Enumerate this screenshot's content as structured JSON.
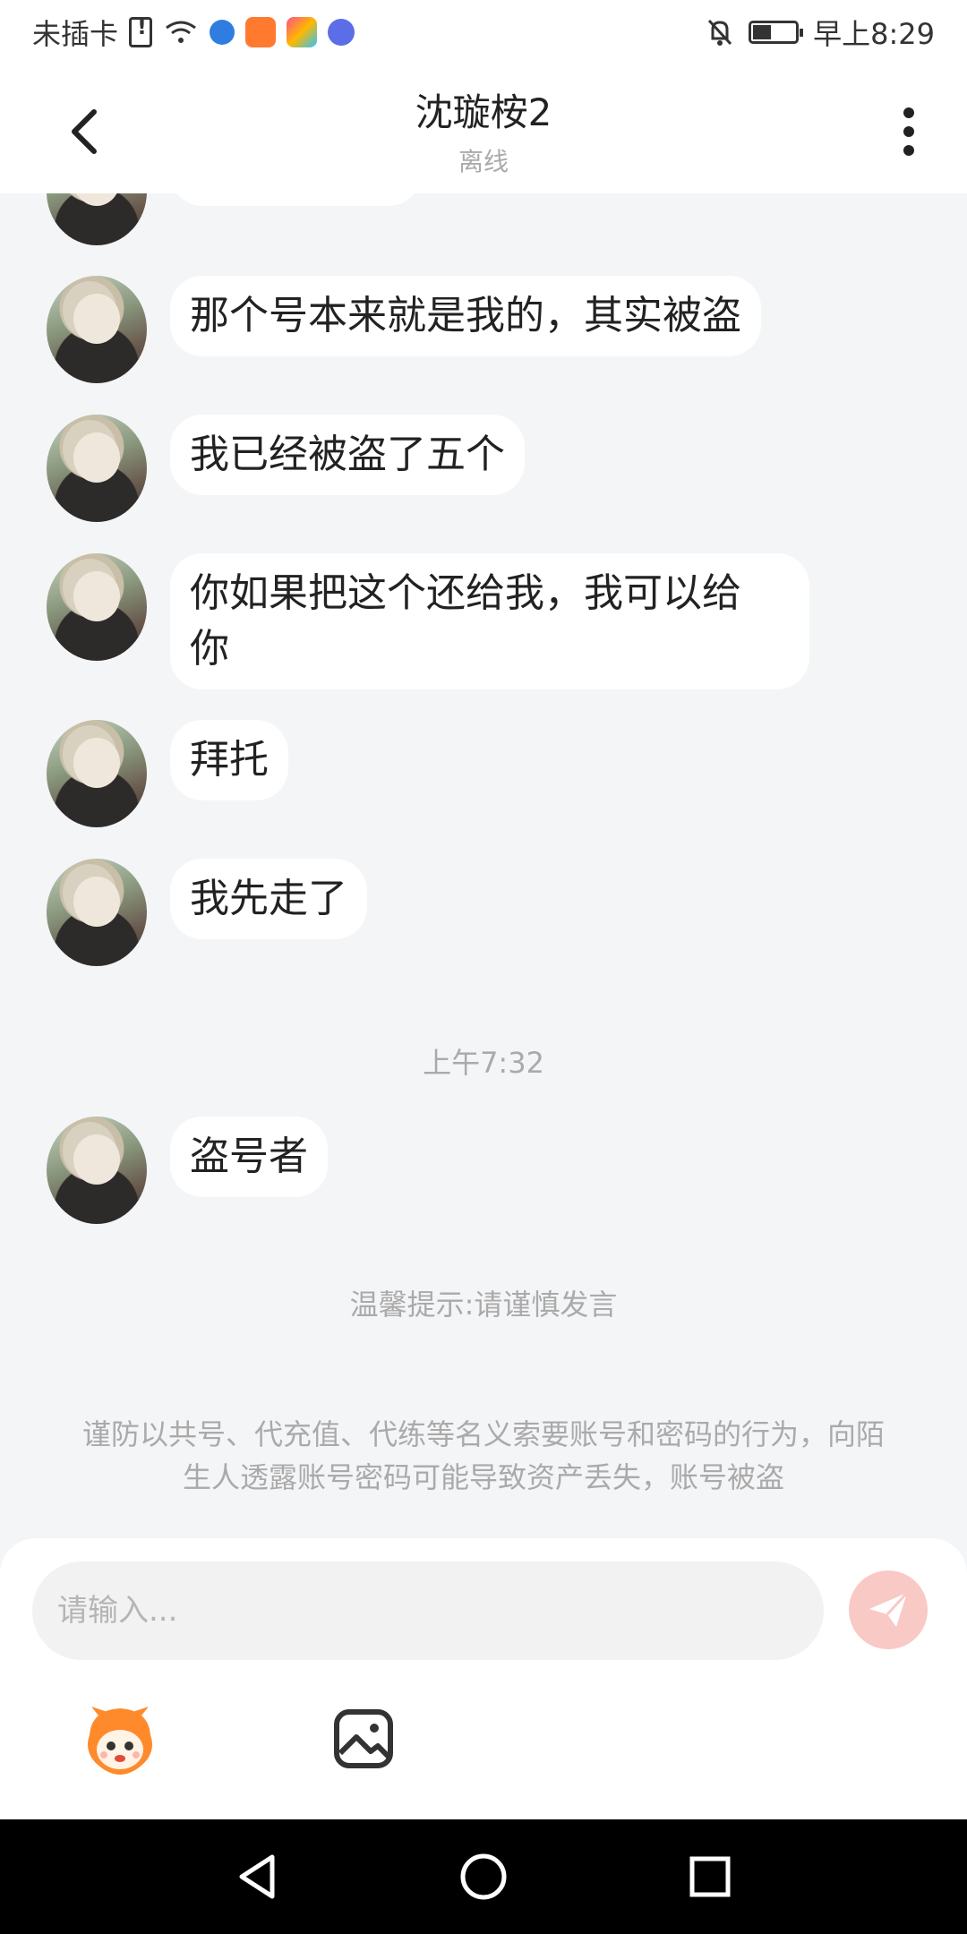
{
  "status_bar": {
    "carrier": "未插卡",
    "time": "早上8:29"
  },
  "header": {
    "title": "沈璇桉2",
    "subtitle": "离线"
  },
  "messages": [
    {
      "text": "那个号本来就是我的，其实被盗"
    },
    {
      "text": "我已经被盗了五个"
    },
    {
      "text": "你如果把这个还给我，我可以给\n你"
    },
    {
      "text": "拜托"
    },
    {
      "text": "我先走了"
    },
    {
      "text": "盗号者"
    }
  ],
  "timestamp": "上午7:32",
  "tip": "温馨提示:请谨慎发言",
  "warning": "谨防以共号、代充值、代练等名义索要账号和密码的行为，向陌生人透露账号密码可能导致资产丢失，账号被盗",
  "composer": {
    "placeholder": "请输入..."
  },
  "colors": {
    "background": "#f4f5f7",
    "bubble": "#ffffff",
    "send_button": "#f9c9c6",
    "muted_text": "#aaaaaa"
  },
  "icons": {
    "back": "chevron-left-icon",
    "more": "more-vertical-icon",
    "send": "paper-plane-icon",
    "emoji": "mascot-emoji-icon",
    "image": "image-icon"
  }
}
